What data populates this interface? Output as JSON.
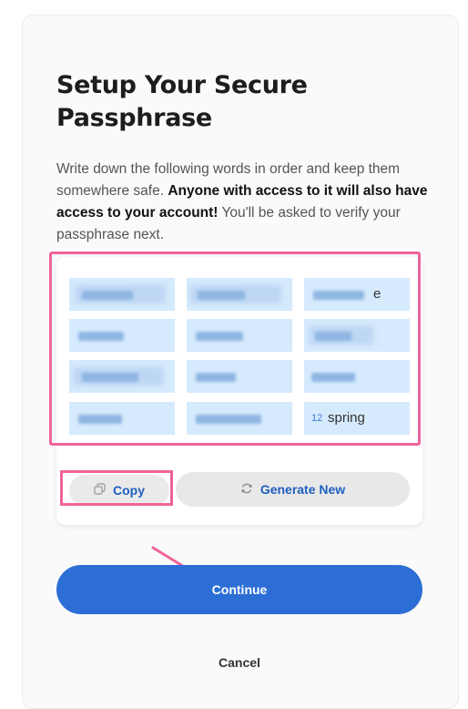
{
  "title": "Setup Your Secure Passphrase",
  "description": {
    "part1": "Write down the following words in order and keep them somewhere safe. ",
    "bold": "Anyone with access to it will also have access to your account!",
    "part2": " You'll be asked to verify your passphrase next."
  },
  "words": [
    {
      "number": "",
      "text": ""
    },
    {
      "number": "",
      "text": ""
    },
    {
      "number": "",
      "text": "e"
    },
    {
      "number": "",
      "text": ""
    },
    {
      "number": "",
      "text": ""
    },
    {
      "number": "",
      "text": ""
    },
    {
      "number": "",
      "text": ""
    },
    {
      "number": "",
      "text": ""
    },
    {
      "number": "",
      "text": ""
    },
    {
      "number": "",
      "text": ""
    },
    {
      "number": "",
      "text": ""
    },
    {
      "number": "12",
      "text": "spring"
    }
  ],
  "buttons": {
    "copy": "Copy",
    "generate": "Generate New",
    "continue": "Continue",
    "cancel": "Cancel"
  },
  "colors": {
    "accent": "#2c6ed5",
    "highlight": "#f0629a",
    "word_bg": "#d6eafd"
  }
}
